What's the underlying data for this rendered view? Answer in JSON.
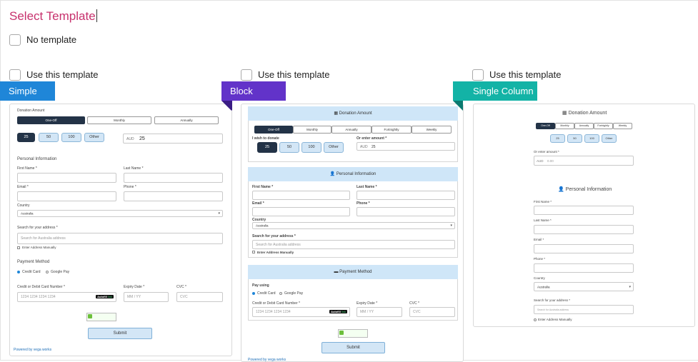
{
  "page": {
    "title": "Select Template"
  },
  "no_template": {
    "label": "No template"
  },
  "use_template_label": "Use this template",
  "templates": [
    {
      "name": "Simple",
      "color": "#1f86d8"
    },
    {
      "name": "Block",
      "color": "#6233c9"
    },
    {
      "name": "Single Column",
      "color": "#13b3a6"
    }
  ],
  "form": {
    "donation_amount": "Donation Amount",
    "frequency": [
      "One-Off",
      "Monthly",
      "Annually",
      "Fortnightly",
      "Weekly"
    ],
    "amounts": [
      "25",
      "50",
      "100",
      "Other"
    ],
    "currency": "AUD",
    "amount_value": "25",
    "amount_value_alt": "0.00",
    "i_wish_to_donate": "I wish to donate",
    "or_enter_amount": "Or enter amount *",
    "personal_information": "Personal Information",
    "first_name": "First Name *",
    "last_name": "Last Name *",
    "email": "Email *",
    "phone": "Phone *",
    "country": "Country",
    "country_value": "Australia",
    "search_address": "Search for your address *",
    "search_address_placeholder": "Search for Australia address",
    "enter_manually": "Enter Address Manually",
    "payment_method": "Payment Method",
    "pay_using": "Pay using",
    "credit_card": "Credit Card",
    "google_pay": "Google Pay",
    "card_number_label": "Credit or Debit Card Number *",
    "card_number_placeholder": "1234 1234 1234 1234",
    "autofill": "Autofill",
    "autofill_link": "link",
    "expiry_label": "Expiry Date *",
    "expiry_placeholder": "MM / YY",
    "cvc_label": "CVC *",
    "cvc_placeholder": "CVC",
    "submit": "Submit",
    "powered_by": "Powered by vega works"
  }
}
